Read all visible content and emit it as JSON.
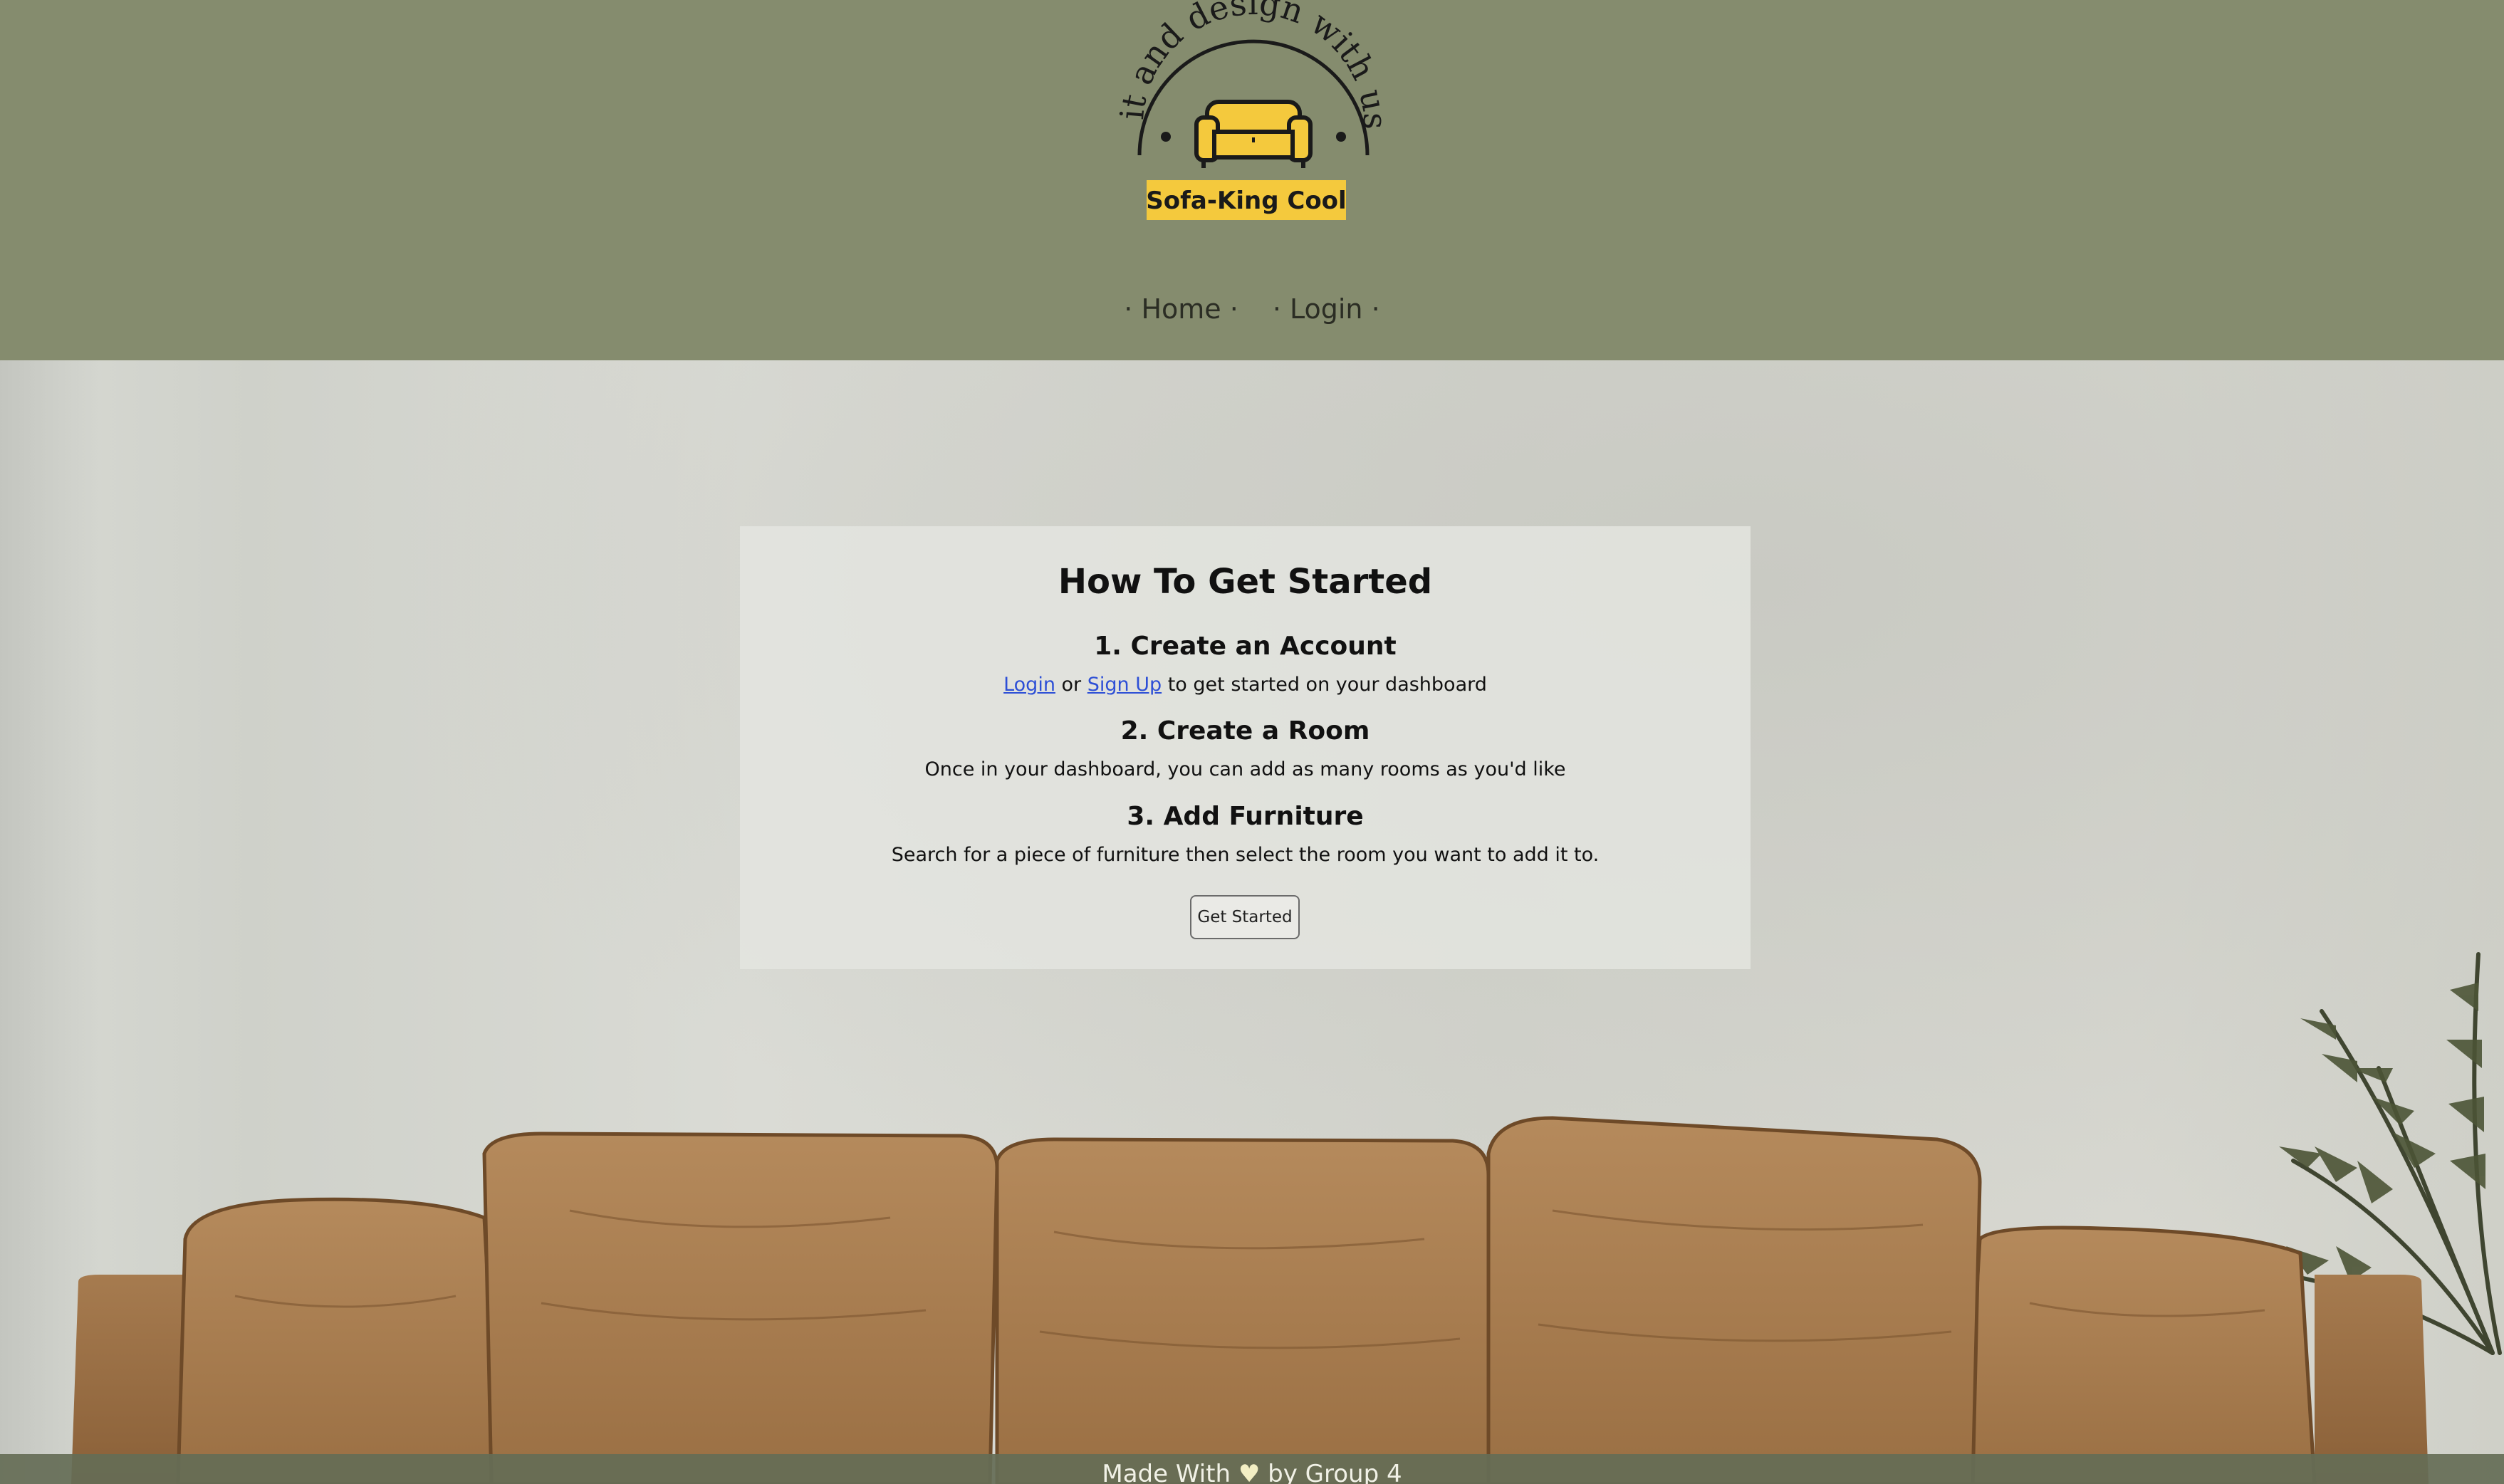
{
  "logo": {
    "arc_text": "Sit and design with us!",
    "brand": "Sofa-King Cool",
    "icon": "sofa-icon"
  },
  "nav": {
    "items": [
      {
        "label": "· Home ·"
      },
      {
        "label": "· Login ·"
      }
    ]
  },
  "card": {
    "title": "How To Get Started",
    "step1": {
      "title": "1. Create an Account",
      "link_login": "Login",
      "or": "or",
      "link_signup": "Sign Up",
      "rest": "to get started on your dashboard"
    },
    "step2": {
      "title": "2. Create a Room",
      "text": "Once in your dashboard, you can add as many rooms as you'd like"
    },
    "step3": {
      "title": "3. Add Furniture",
      "text": "Search for a piece of furniture then select the room you want to add it to."
    },
    "button": "Get Started"
  },
  "footer": {
    "prefix": "Made With",
    "heart": "♥",
    "suffix": "by Group 4"
  },
  "colors": {
    "header_bg": "#858c6e",
    "logo_yellow": "#f4c93d",
    "link": "#2d4fd6"
  }
}
